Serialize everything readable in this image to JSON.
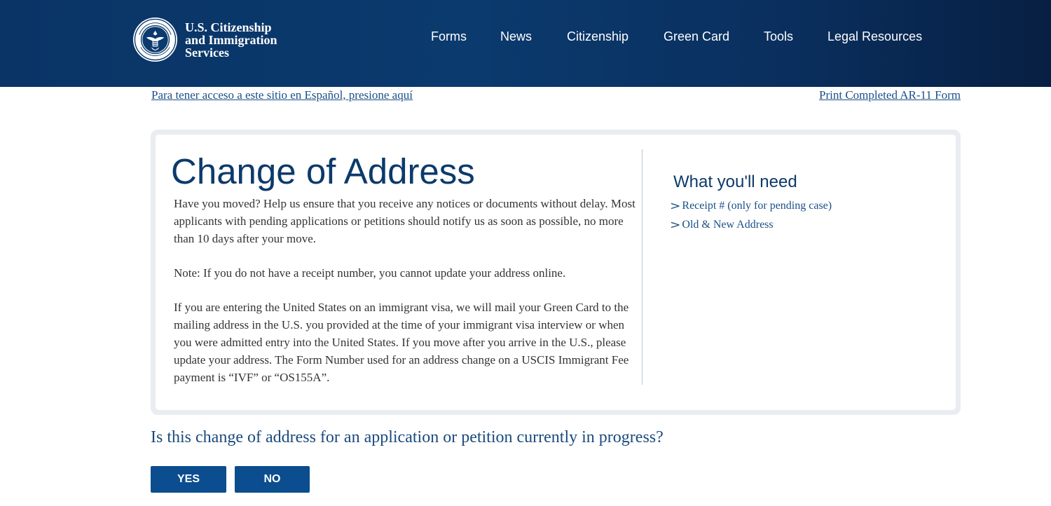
{
  "header": {
    "logo_icon": "dhs-seal-icon",
    "logo_lines": [
      "U.S. Citizenship",
      "and Immigration",
      "Services"
    ],
    "nav": [
      {
        "label": "Forms"
      },
      {
        "label": "News"
      },
      {
        "label": "Citizenship"
      },
      {
        "label": "Green Card"
      },
      {
        "label": "Tools"
      },
      {
        "label": "Legal Resources"
      }
    ],
    "background_color": "#0b3a6e"
  },
  "top_links": {
    "spanish": "Para tener acceso a este sitio en Español, presione aquí",
    "print": "Print Completed AR-11 Form"
  },
  "card": {
    "title": "Change of Address",
    "paragraphs": [
      "Have you moved? Help us ensure that you receive any notices or documents without delay. Most applicants with pending applications or petitions should notify us as soon as possible, no more than 10 days after your move.",
      "Note: If you do not have a receipt number, you cannot update your address online.",
      "If you are entering the United States on an immigrant visa, we will mail your Green Card to the mailing address in the U.S. you provided at the time of your immigrant visa interview or when you were admitted entry into the United States. If you move after you arrive in the U.S., please update your address. The Form Number used for an address change on a USCIS Immigrant Fee payment is “IVF” or “OS155A”."
    ],
    "needs": {
      "title": "What you'll need",
      "item_icon": "chevron-right-icon",
      "items": [
        "Receipt # (only for pending case)",
        "Old & New Address"
      ]
    }
  },
  "question": {
    "text": "Is this change of address for an application or petition currently in progress?",
    "yes_label": "YES",
    "no_label": "NO"
  },
  "colors": {
    "accent": "#0b4d8e",
    "link": "#1a4f88",
    "heading": "#0c3a6b"
  }
}
